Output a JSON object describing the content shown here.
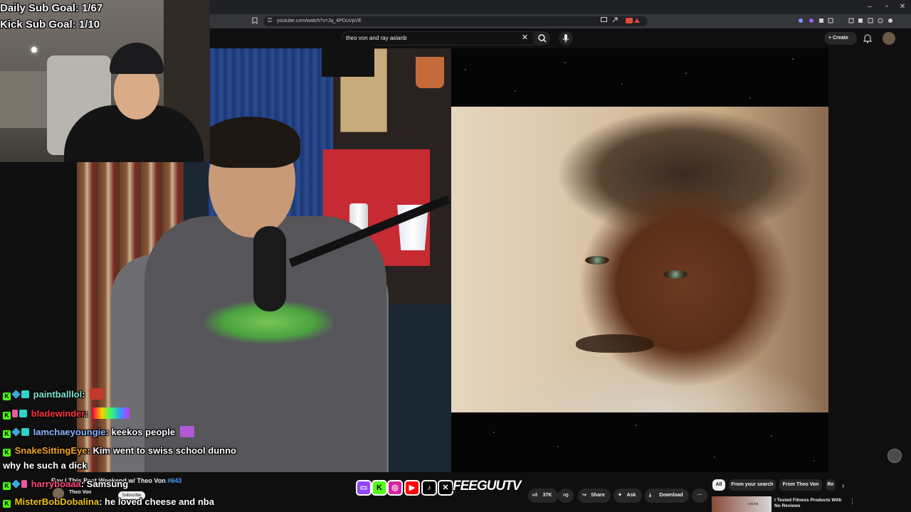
{
  "browser": {
    "url": "youtube.com/watch?v=Jq_4POuVpVE",
    "window_controls": [
      "–",
      "▫",
      "✕"
    ]
  },
  "youtube": {
    "search_query": "theo von and ray asianb",
    "create_label": "Create",
    "video": {
      "title_prefix": "Ray | This Past Weekend w/ Theo Von",
      "episode": "#643",
      "channel": "Theo Von",
      "subscribe_label": "Subscribe",
      "likes": "37K",
      "share_label": "Share",
      "ask_label": "Ask",
      "download_label": "Download",
      "more_label": "···"
    },
    "chips": [
      "All",
      "From your search",
      "From Theo Von",
      "Re"
    ],
    "recommendation": {
      "title": "I Tested Fitness Products With No Reviews",
      "thumb_text": "natural"
    }
  },
  "overlay": {
    "daily_sub_goal": "Daily Sub Goal: 1/67",
    "kick_sub_goal": "Kick Sub Goal: 1/10",
    "brand": "FEEGUUTV"
  },
  "chat": [
    {
      "user": "paintballlol",
      "color": "#7fe7d2",
      "message": ""
    },
    {
      "user": "bladewinder",
      "color": "#ff3344",
      "message": ""
    },
    {
      "user": "Iamchaeyoungie",
      "color": "#8fb8ff",
      "message": "keekos people"
    },
    {
      "user": "SnakeSittingEye",
      "color": "#f5a623",
      "message": "Kim went to swiss school dunno"
    },
    {
      "user": "",
      "color": "#ffffff",
      "message": "why he such a dick"
    },
    {
      "user": "harryboaaa",
      "color": "#ff4d7a",
      "message": "Samsung"
    },
    {
      "user": "MisterBobDobalina",
      "color": "#f1c40f",
      "message": "he loved cheese and nba"
    }
  ],
  "colors": {
    "youtube_bg": "#0f0f0f",
    "kick_green": "#53fc18",
    "link_blue": "#3ea6ff"
  }
}
